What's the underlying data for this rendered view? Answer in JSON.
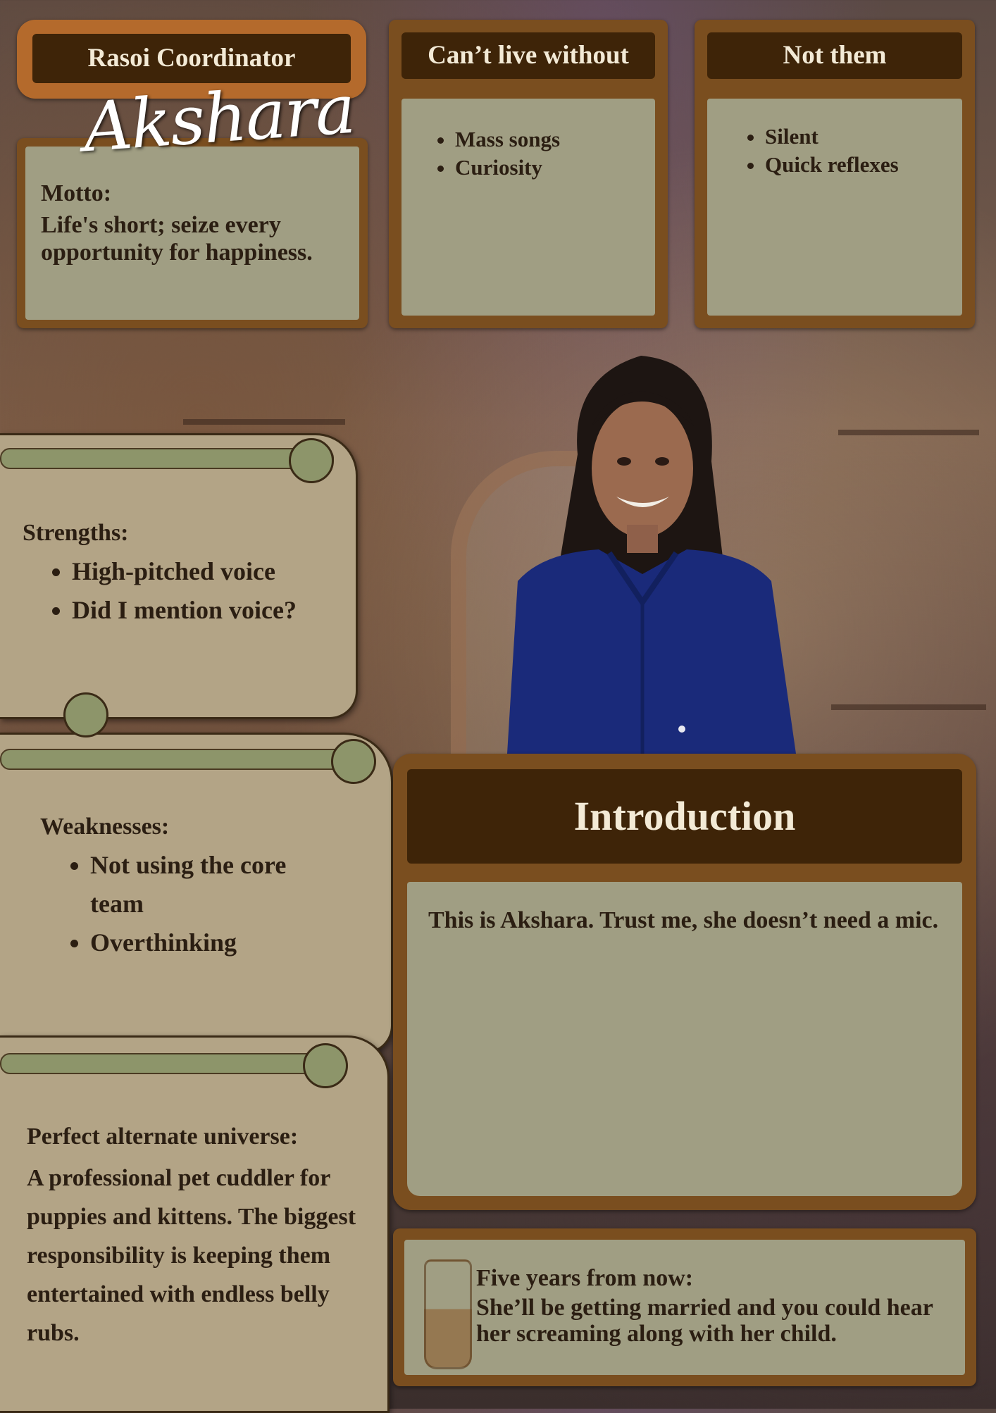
{
  "role_title": "Rasoi Coordinator",
  "name": "Akshara",
  "motto": {
    "label": "Motto:",
    "text": "Life's short; seize every opportunity for happiness."
  },
  "cant_live_without": {
    "title": "Can’t live without",
    "items": [
      "Mass songs",
      "Curiosity"
    ]
  },
  "not_them": {
    "title": "Not them",
    "items": [
      "Silent",
      "Quick reflexes"
    ]
  },
  "strengths": {
    "label": "Strengths:",
    "items": [
      "High-pitched voice",
      "Did I mention voice?"
    ]
  },
  "weaknesses": {
    "label": "Weaknesses:",
    "items": [
      "Not using the core team",
      "Overthinking"
    ]
  },
  "alternate_universe": {
    "label": "Perfect alternate universe:",
    "text": "A professional pet cuddler for puppies and kittens. The biggest responsibility is keeping them entertained with endless belly rubs."
  },
  "introduction": {
    "title": "Introduction",
    "text": "This is Akshara. Trust me, she doesn’t need a mic."
  },
  "five_years": {
    "label": "Five years from now:",
    "text": "She’ll be getting married and you could hear her screaming along with her child."
  },
  "colors": {
    "frame": "#7a4e1f",
    "header": "#3e2408",
    "panel": "#a09e83",
    "scroll": "#b3a486",
    "scroll_curl": "#8d956a",
    "shirt": "#1a2a7a"
  }
}
